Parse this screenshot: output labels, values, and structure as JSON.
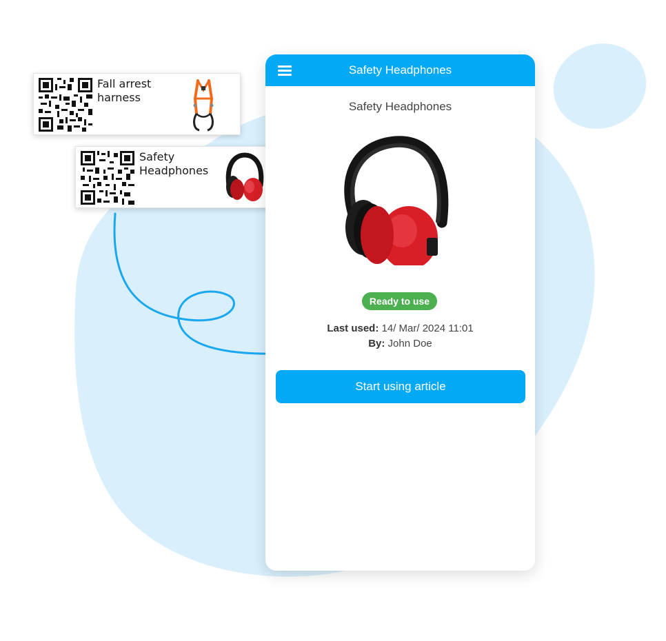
{
  "app_bar": {
    "title": "Safety Headphones",
    "menu_icon": "hamburger-menu-icon"
  },
  "article": {
    "title": "Safety Headphones",
    "image_icon": "safety-earmuffs-image",
    "status": "Ready to use",
    "status_color": "#4caf50",
    "last_used_label": "Last used:",
    "last_used_value": " 14/ Mar/ 2024 11:01",
    "by_label": "By:",
    "by_value": " John Doe",
    "start_button": "Start using article"
  },
  "qr_labels": [
    {
      "name": "Fall arrest harness",
      "thumb_icon": "harness-image"
    },
    {
      "name": "Safety Headphones",
      "thumb_icon": "earmuffs-image"
    }
  ],
  "colors": {
    "accent": "#03a9f4",
    "background_blob": "#d9f0fc",
    "arrow": "#1aa7f0"
  }
}
